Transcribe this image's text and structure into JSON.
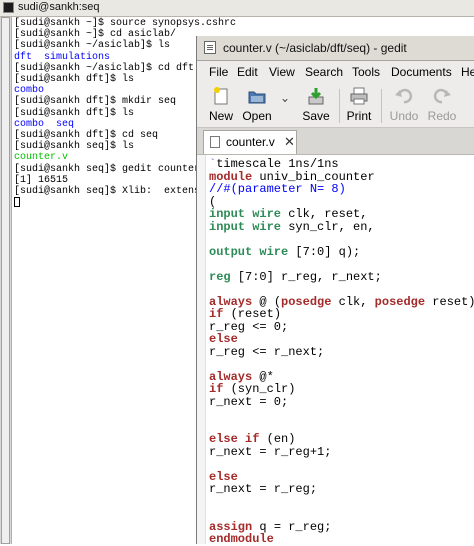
{
  "terminal": {
    "title": "sudi@sankh:seq",
    "lines": [
      [
        {
          "t": "[sudi@sankh ~]$ source synopsys.cshrc",
          "c": ""
        }
      ],
      [
        {
          "t": "[sudi@sankh ~]$ cd asiclab/",
          "c": ""
        }
      ],
      [
        {
          "t": "[sudi@sankh ~/asiclab]$ ls",
          "c": ""
        }
      ],
      [
        {
          "t": "dft  simulations",
          "c": "blue"
        }
      ],
      [
        {
          "t": "[sudi@sankh ~/asiclab]$ cd dft",
          "c": ""
        }
      ],
      [
        {
          "t": "[sudi@sankh dft]$ ls",
          "c": ""
        }
      ],
      [
        {
          "t": "combo",
          "c": "blue"
        }
      ],
      [
        {
          "t": "[sudi@sankh dft]$ mkdir seq",
          "c": ""
        }
      ],
      [
        {
          "t": "[sudi@sankh dft]$ ls",
          "c": ""
        }
      ],
      [
        {
          "t": "combo  seq",
          "c": "blue"
        }
      ],
      [
        {
          "t": "[sudi@sankh dft]$ cd seq",
          "c": ""
        }
      ],
      [
        {
          "t": "[sudi@sankh seq]$ ls",
          "c": ""
        }
      ],
      [
        {
          "t": "counter.v",
          "c": "green"
        }
      ],
      [
        {
          "t": "[sudi@sankh seq]$ gedit counter.v &",
          "c": ""
        }
      ],
      [
        {
          "t": "[1] 16515",
          "c": ""
        }
      ],
      [
        {
          "t": "[sudi@sankh seq]$ Xlib:  extension \"R",
          "c": ""
        }
      ]
    ]
  },
  "gedit": {
    "title": "counter.v (~/asiclab/dft/seq) - gedit",
    "menu": [
      "File",
      "Edit",
      "View",
      "Search",
      "Tools",
      "Documents",
      "He"
    ],
    "toolbar": {
      "new": "New",
      "open": "Open",
      "save": "Save",
      "print": "Print",
      "undo": "Undo",
      "redo": "Redo"
    },
    "tab_label": "counter.v",
    "tab_close": "✕",
    "code": [
      [
        {
          "t": "`",
          "c": "dir"
        },
        {
          "t": "timescale 1ns/1ns",
          "c": ""
        }
      ],
      [
        {
          "t": "module",
          "c": "kw"
        },
        {
          "t": " univ_bin_counter",
          "c": ""
        }
      ],
      [
        {
          "t": "//#(parameter N= 8)",
          "c": "cm"
        }
      ],
      [
        {
          "t": "(",
          "c": ""
        }
      ],
      [
        {
          "t": "input wire",
          "c": "ty"
        },
        {
          "t": " clk, reset,",
          "c": ""
        }
      ],
      [
        {
          "t": "input wire",
          "c": "ty"
        },
        {
          "t": " syn_clr, en,",
          "c": ""
        }
      ],
      [
        {
          "t": "",
          "c": ""
        }
      ],
      [
        {
          "t": "output wire",
          "c": "ty"
        },
        {
          "t": " [7:0] q);",
          "c": ""
        }
      ],
      [
        {
          "t": "",
          "c": ""
        }
      ],
      [
        {
          "t": "reg",
          "c": "ty"
        },
        {
          "t": " [7:0] r_reg, r_next;",
          "c": ""
        }
      ],
      [
        {
          "t": "",
          "c": ""
        }
      ],
      [
        {
          "t": "always",
          "c": "kw"
        },
        {
          "t": " @ (",
          "c": ""
        },
        {
          "t": "posedge",
          "c": "kw"
        },
        {
          "t": " clk, ",
          "c": ""
        },
        {
          "t": "posedge",
          "c": "kw"
        },
        {
          "t": " reset)",
          "c": ""
        }
      ],
      [
        {
          "t": "if",
          "c": "kw"
        },
        {
          "t": " (reset)",
          "c": ""
        }
      ],
      [
        {
          "t": "r_reg <= 0;",
          "c": ""
        }
      ],
      [
        {
          "t": "else",
          "c": "kw"
        }
      ],
      [
        {
          "t": "r_reg <= r_next;",
          "c": ""
        }
      ],
      [
        {
          "t": "",
          "c": ""
        }
      ],
      [
        {
          "t": "always",
          "c": "kw"
        },
        {
          "t": " @*",
          "c": ""
        }
      ],
      [
        {
          "t": "if",
          "c": "kw"
        },
        {
          "t": " (syn_clr)",
          "c": ""
        }
      ],
      [
        {
          "t": "r_next = 0;",
          "c": ""
        }
      ],
      [
        {
          "t": "",
          "c": ""
        }
      ],
      [
        {
          "t": "",
          "c": ""
        }
      ],
      [
        {
          "t": "else if",
          "c": "kw"
        },
        {
          "t": " (en)",
          "c": ""
        }
      ],
      [
        {
          "t": "r_next = r_reg+1;",
          "c": ""
        }
      ],
      [
        {
          "t": "",
          "c": ""
        }
      ],
      [
        {
          "t": "else",
          "c": "kw"
        }
      ],
      [
        {
          "t": "r_next = r_reg;",
          "c": ""
        }
      ],
      [
        {
          "t": "",
          "c": ""
        }
      ],
      [
        {
          "t": "",
          "c": ""
        }
      ],
      [
        {
          "t": "assign",
          "c": "kw"
        },
        {
          "t": " q = r_reg;",
          "c": ""
        }
      ],
      [
        {
          "t": "endmodule",
          "c": "kw"
        }
      ]
    ]
  },
  "icons": {
    "terminal": "terminal-icon",
    "app": "gedit-app-icon",
    "new": "new-document-icon",
    "open": "folder-open-icon",
    "save": "save-icon",
    "print": "printer-icon",
    "undo": "undo-icon",
    "redo": "redo-icon"
  },
  "colors": {
    "keyword": "#a52a2a",
    "type": "#2e8b57",
    "comment": "#0000ff",
    "directory": "#0000ff",
    "executable": "#00c000"
  }
}
